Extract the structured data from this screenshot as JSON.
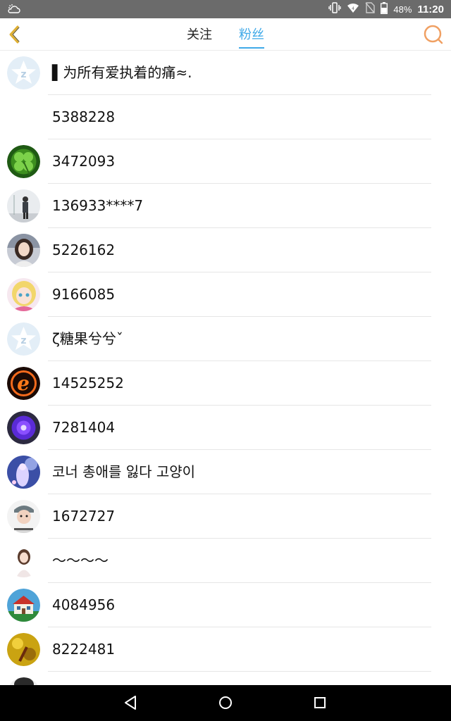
{
  "status_bar": {
    "battery": "48%",
    "time": "11:20"
  },
  "header": {
    "tabs": [
      {
        "label": "关注",
        "active": false
      },
      {
        "label": "粉丝",
        "active": true
      }
    ]
  },
  "accent_color": "#3fa9e8",
  "users": [
    {
      "name": "▌为所有爱执着的痛≈.",
      "avatar": "default-qzone"
    },
    {
      "name": "5388228",
      "avatar": "none"
    },
    {
      "name": "3472093",
      "avatar": "clover"
    },
    {
      "name": "136933****7",
      "avatar": "person-street"
    },
    {
      "name": "5226162",
      "avatar": "girl-photo"
    },
    {
      "name": "9166085",
      "avatar": "anime-girl"
    },
    {
      "name": "ζ糖果兮兮ˇ",
      "avatar": "default-qzone"
    },
    {
      "name": "14525252",
      "avatar": "fire-e"
    },
    {
      "name": "7281404",
      "avatar": "purple-flower"
    },
    {
      "name": "코너 총애를 잃다 고양이",
      "avatar": "fantasy-art"
    },
    {
      "name": "1672727",
      "avatar": "boy-cap"
    },
    {
      "name": "～～～～",
      "avatar": "girl-white"
    },
    {
      "name": "4084956",
      "avatar": "house"
    },
    {
      "name": "8222481",
      "avatar": "yellow-scene"
    },
    {
      "name": "",
      "avatar": "partial"
    }
  ]
}
